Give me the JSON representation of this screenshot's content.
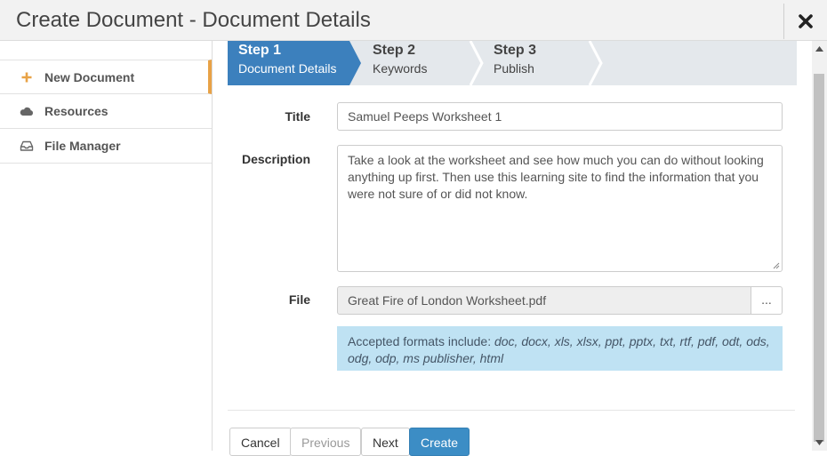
{
  "header": {
    "title": "Create Document - Document Details",
    "close_icon": "close-icon"
  },
  "sidebar": {
    "items": [
      {
        "label": "New Document",
        "icon": "plus-icon",
        "active": true
      },
      {
        "label": "Resources",
        "icon": "cloud-icon",
        "active": false
      },
      {
        "label": "File Manager",
        "icon": "inbox-icon",
        "active": false
      }
    ]
  },
  "steps": [
    {
      "title": "Step 1",
      "subtitle": "Document Details",
      "active": true
    },
    {
      "title": "Step 2",
      "subtitle": "Keywords",
      "active": false
    },
    {
      "title": "Step 3",
      "subtitle": "Publish",
      "active": false
    }
  ],
  "form": {
    "title_label": "Title",
    "title_value": "Samuel Peeps Worksheet 1",
    "description_label": "Description",
    "description_value": "Take a look at the worksheet and see how much you can do without looking anything up first. Then use this learning site to find the information that you were not sure of or did not know.",
    "file_label": "File",
    "file_value": "Great Fire of London Worksheet.pdf",
    "file_button": "...",
    "accepted_intro": "Accepted formats include: ",
    "accepted_formats": "doc, docx, xls, xlsx, ppt, pptx, txt, rtf, pdf, odt, ods, odg, odp, ms publisher, html"
  },
  "buttons": {
    "cancel": "Cancel",
    "previous": "Previous",
    "next": "Next",
    "create": "Create"
  },
  "colors": {
    "active_step": "#3c80bd",
    "inactive_step": "#e4e8ec",
    "primary_button": "#3c8dc5",
    "active_nav_marker": "#e8a246",
    "info_background": "#bfe2f3"
  }
}
